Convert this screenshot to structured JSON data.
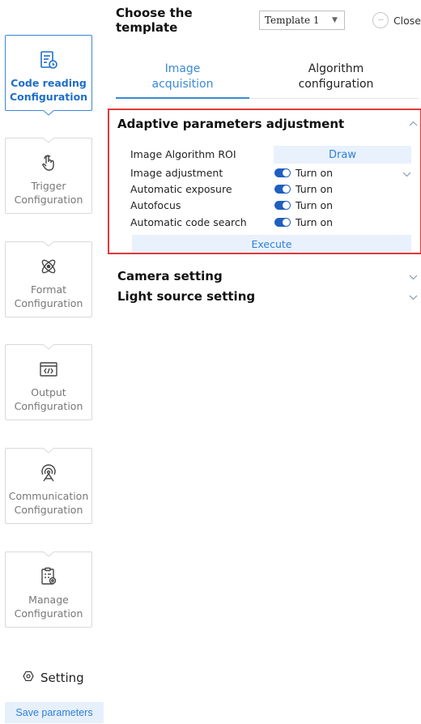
{
  "sidebar": {
    "items": [
      {
        "label_1": "Code reading",
        "label_2": "Configuration",
        "icon": "code-reading-icon",
        "active": true
      },
      {
        "label_1": "Trigger",
        "label_2": "Configuration",
        "icon": "pointer-hand-icon",
        "active": false
      },
      {
        "label_1": "Format",
        "label_2": "Configuration",
        "icon": "atom-format-icon",
        "active": false
      },
      {
        "label_1": "Output",
        "label_2": "Configuration",
        "icon": "code-output-icon",
        "active": false
      },
      {
        "label_1": "Communication",
        "label_2": "Configuration",
        "icon": "antenna-icon",
        "active": false
      },
      {
        "label_1": "Manage",
        "label_2": "Configuration",
        "icon": "manage-icon",
        "active": false
      }
    ],
    "setting_label": "Setting",
    "save_label": "Save parameters"
  },
  "header": {
    "title": "Choose the template",
    "template_value": "Template 1",
    "close_label": "Close"
  },
  "tabs": [
    {
      "line1": "Image",
      "line2": "acquisition",
      "active": true
    },
    {
      "line1": "Algorithm",
      "line2": "configuration",
      "active": false
    }
  ],
  "adaptive": {
    "title": "Adaptive parameters adjustment",
    "roi_label": "Image Algorithm ROI",
    "draw_label": "Draw",
    "rows": [
      {
        "label": "Image adjustment",
        "state": "Turn on"
      },
      {
        "label": "Automatic exposure",
        "state": "Turn on"
      },
      {
        "label": "Autofocus",
        "state": "Turn on"
      },
      {
        "label": "Automatic code search",
        "state": "Turn on"
      }
    ],
    "execute_label": "Execute"
  },
  "sections": {
    "camera": "Camera setting",
    "light": "Light source setting"
  },
  "colors": {
    "accent": "#3a8ad8",
    "highlight_border": "#e03a3a",
    "toggle_on": "#1f5fbf"
  }
}
